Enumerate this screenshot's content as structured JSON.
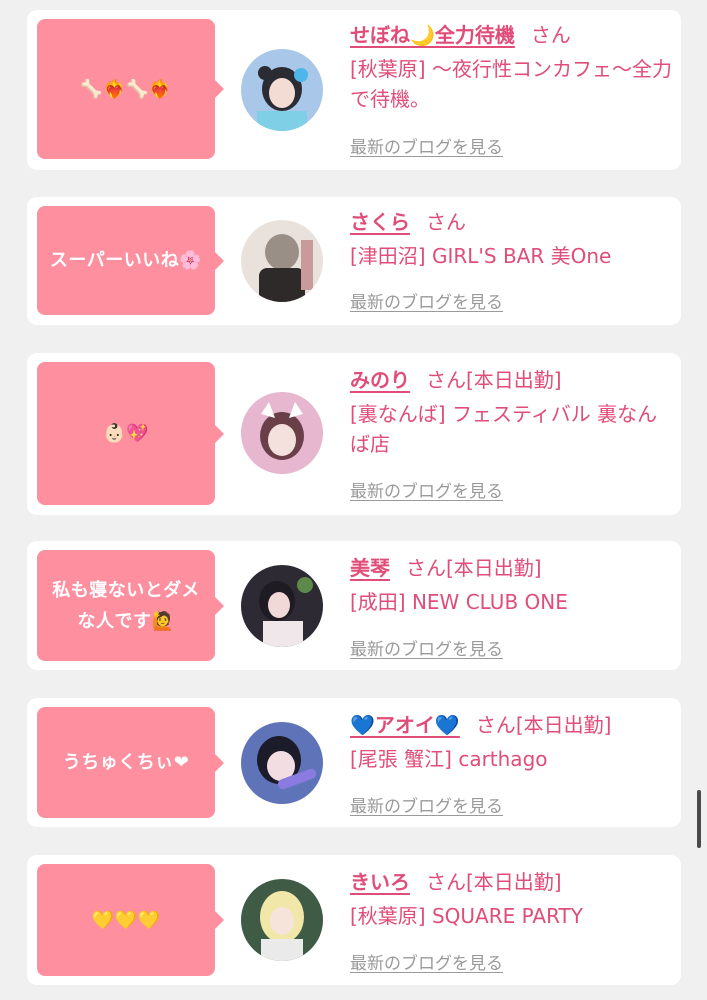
{
  "cards": [
    {
      "comment": "🦴❤️‍🔥🦴❤️‍🔥",
      "name": "せぼね🌙全力待機",
      "san": "さん",
      "status": "",
      "shop": "[秋葉原] 〜夜行性コンカフェ〜全力で待機。",
      "blog_link": "最新のブログを見る"
    },
    {
      "comment": "スーパーいいね🌸",
      "name": "さくら",
      "san": "さん",
      "status": "",
      "shop": "[津田沼] GIRL'S BAR 美One",
      "blog_link": "最新のブログを見る"
    },
    {
      "comment": "👶🏻💖",
      "name": "みのり",
      "san": "さん",
      "status": "[本日出勤]",
      "shop": "[裏なんば] フェスティバル 裏なんば店",
      "blog_link": "最新のブログを見る"
    },
    {
      "comment": "私も寝ないとダメな人です🙋",
      "name": "美琴",
      "san": "さん",
      "status": "[本日出勤]",
      "shop": "[成田] NEW CLUB ONE",
      "blog_link": "最新のブログを見る"
    },
    {
      "comment": "うちゅくちぃ❤",
      "name": "💙アオイ💙",
      "san": "さん",
      "status": "[本日出勤]",
      "shop": "[尾張 蟹江] carthago",
      "blog_link": "最新のブログを見る"
    },
    {
      "comment": "💛💛💛",
      "name": "きいろ",
      "san": "さん",
      "status": "[本日出勤]",
      "shop": "[秋葉原] SQUARE PARTY",
      "blog_link": "最新のブログを見る"
    }
  ],
  "colors": {
    "accent": "#e04d78",
    "bubble": "#fd8f9f",
    "link_gray": "#9a9a9a",
    "background": "#f0f0f0"
  }
}
